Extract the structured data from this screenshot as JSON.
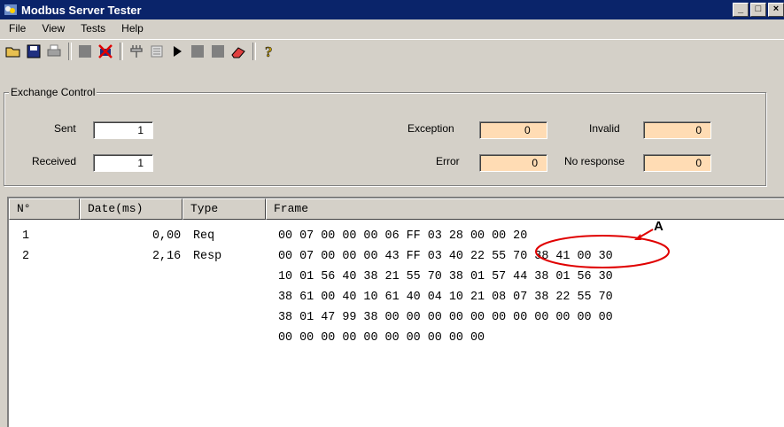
{
  "window": {
    "title": "Modbus Server Tester",
    "buttons": [
      "_",
      "□",
      "×"
    ]
  },
  "menu": [
    "File",
    "View",
    "Tests",
    "Help"
  ],
  "toolbar": {
    "icons": [
      "open-folder-icon",
      "save-icon",
      "print-icon",
      "stop-square-icon",
      "disconnect-icon",
      "connect-plug-icon",
      "list-icon",
      "play-icon",
      "square-icon",
      "square-icon",
      "eraser-icon",
      "help-icon"
    ]
  },
  "exchange": {
    "title": "Exchange Control",
    "sent_label": "Sent",
    "sent": "1",
    "received_label": "Received",
    "received": "1",
    "exception_label": "Exception",
    "exception": "0",
    "error_label": "Error",
    "error": "0",
    "invalid_label": "Invalid",
    "invalid": "0",
    "noresp_label": "No response",
    "noresp": "0"
  },
  "table": {
    "headers": [
      "N°",
      "Date(ms)",
      "Type",
      "Frame"
    ],
    "rows": [
      {
        "n": "1",
        "date": "0,00",
        "type": "Req",
        "frame": [
          "00 07 00 00 00 06 FF 03 28 00 00 20"
        ]
      },
      {
        "n": "2",
        "date": "2,16",
        "type": "Resp",
        "frame": [
          "00 07 00 00 00 43 FF 03 40 22 55 70 38 41 00 30",
          "10 01 56 40 38 21 55 70 38 01 57 44 38 01 56 30",
          "38 61 00 40 10 61 40 04 10 21 08 07 38 22 55 70",
          "38 01 47 99 38 00 00 00 00 00 00 00 00 00 00 00",
          "00 00 00 00 00 00 00 00 00 00"
        ]
      }
    ]
  },
  "annotation": {
    "label": "A",
    "color": "#e00000"
  },
  "colors": {
    "titlebar": "#0a246a",
    "warn_field": "#ffdcb4",
    "face": "#d4d0c8"
  }
}
